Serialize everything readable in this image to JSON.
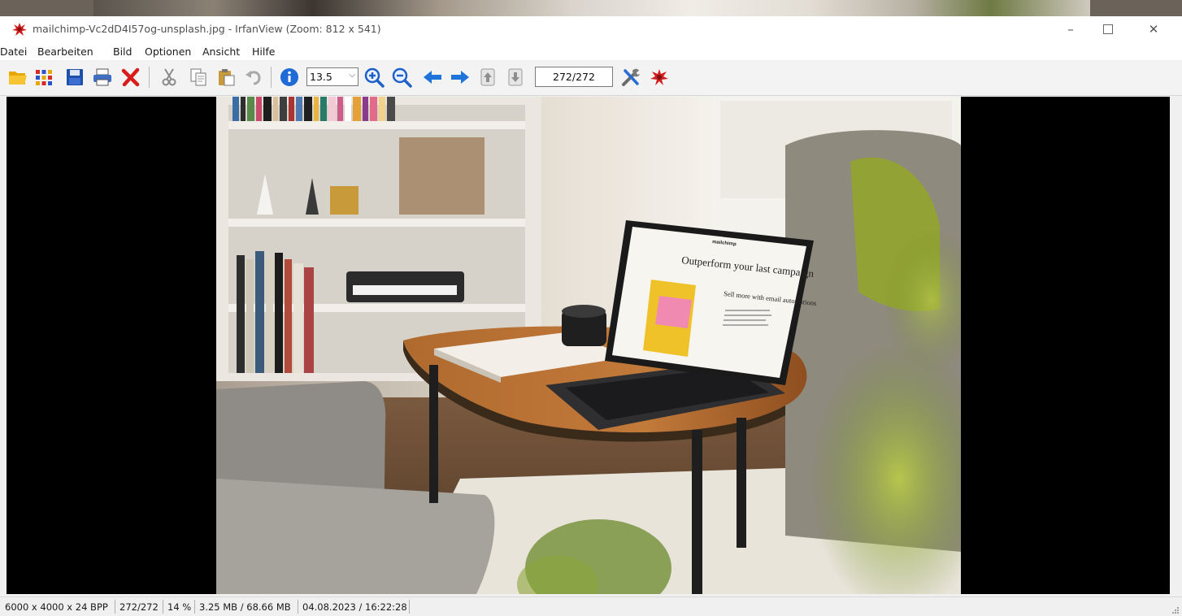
{
  "window": {
    "title": "mailchimp-Vc2dD4I57og-unsplash.jpg - IrfanView (Zoom: 812 x 541)",
    "controls": {
      "minimize": "–",
      "close": "✕"
    }
  },
  "menu": {
    "items": [
      "Datei",
      "Bearbeiten",
      "Bild",
      "Optionen",
      "Ansicht",
      "Hilfe"
    ]
  },
  "toolbar": {
    "zoom_value": "13.5",
    "page_counter": "272/272",
    "icons": [
      "open-folder-icon",
      "thumbnails-icon",
      "save-icon",
      "print-icon",
      "delete-icon",
      "cut-icon",
      "copy-icon",
      "paste-icon",
      "undo-icon",
      "info-icon",
      "zoom-in-icon",
      "zoom-out-icon",
      "previous-arrow-icon",
      "next-arrow-icon",
      "first-file-icon",
      "last-file-icon",
      "settings-icon",
      "irfanview-logo-icon"
    ]
  },
  "photo": {
    "tablet_headline": "Outperform your last campaign",
    "tablet_subheadline": "Sell more with email automations",
    "tablet_brand": "mailchimp"
  },
  "status": {
    "dimensions": "6000 x 4000 x 24 BPP",
    "index": "272/272",
    "zoom": "14 %",
    "memory": "3.25 MB / 68.66 MB",
    "datetime": "04.08.2023 / 16:22:28"
  },
  "colors": {
    "viewer_background": "#000000",
    "titlebar": "#ffffff",
    "toolbar": "#f3f3f3"
  }
}
